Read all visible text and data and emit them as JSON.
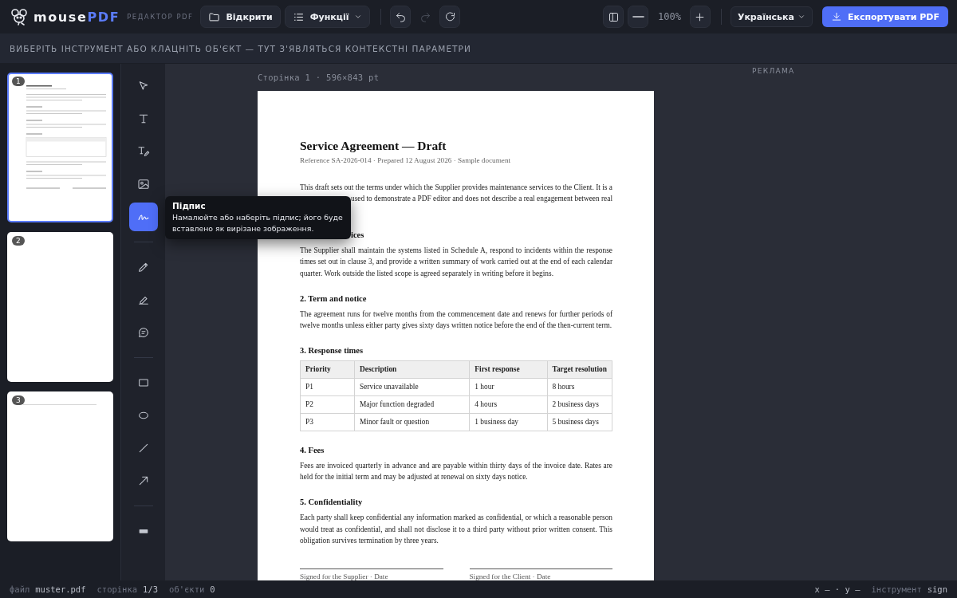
{
  "logo": {
    "name": "mouse",
    "accent": "PDF",
    "subtitle": "РЕДАКТОР PDF"
  },
  "toolbar": {
    "left": [
      {
        "kind": "open",
        "label": "Відкрити",
        "disabled": false
      },
      {
        "kind": "menu",
        "label": "Функції",
        "disabled": false
      },
      {
        "kind": "undo",
        "disabled": false
      },
      {
        "kind": "redo",
        "disabled": true
      },
      {
        "kind": "refresh",
        "disabled": false
      }
    ],
    "right": [
      {
        "kind": "panel",
        "disabled": false
      },
      {
        "kind": "zoom-out",
        "disabled": false
      },
      {
        "kind": "zoom-level",
        "label": "100%"
      },
      {
        "kind": "zoom-in",
        "disabled": false
      }
    ],
    "language": "Українська",
    "export": "Експортувати PDF"
  },
  "context_hint": "ВИБЕРІТЬ ІНСТРУМЕНТ АБО КЛАЦНІТЬ ОБ'ЄКТ — ТУТ З'ЯВЛЯТЬСЯ КОНТЕКСТНІ ПАРАМЕТРИ",
  "thumbnails": [
    {
      "number": "1",
      "selected": true,
      "kind": "document"
    },
    {
      "number": "2",
      "selected": false,
      "kind": "blank"
    },
    {
      "number": "3",
      "selected": false,
      "kind": "line"
    }
  ],
  "tools": [
    {
      "kind": "select",
      "selected": false
    },
    {
      "kind": "text",
      "selected": false
    },
    {
      "kind": "edit-text",
      "selected": false
    },
    {
      "kind": "image",
      "selected": false
    },
    {
      "kind": "signature",
      "selected": true
    },
    {
      "kind": "divider"
    },
    {
      "kind": "pencil",
      "selected": false
    },
    {
      "kind": "highlighter",
      "selected": false
    },
    {
      "kind": "comment",
      "selected": false
    },
    {
      "kind": "divider"
    },
    {
      "kind": "rectangle",
      "selected": false
    },
    {
      "kind": "ellipse",
      "selected": false
    },
    {
      "kind": "line",
      "selected": false
    },
    {
      "kind": "arrow",
      "selected": false
    },
    {
      "kind": "divider"
    },
    {
      "kind": "redact",
      "selected": false
    }
  ],
  "tooltip": {
    "title": "Підпис",
    "text": "Намалюйте або наберіть підпис; його буде вставлено як вирізане зображення."
  },
  "page_label": "Сторінка 1 · 596×843 pt",
  "ad_label": "РЕКЛАМА",
  "document": {
    "title": "Service Agreement — Draft",
    "reference": "Reference SA-2026-014 · Prepared 12 August 2026 · Sample document",
    "blocks": [
      {
        "kind": "line",
        "text": "This draft sets out the terms under which the Supplier provides maintenance services to the Client. It is a"
      },
      {
        "kind": "line-end",
        "text": "used to demonstrate a PDF editor and does not describe a real engagement between real"
      },
      {
        "kind": "heading-end",
        "text": "ices"
      },
      {
        "kind": "paragraph",
        "text": "The Supplier shall maintain the systems listed in Schedule A, respond to incidents within the response times set out in clause 3, and provide a written summary of work carried out at the end of each calendar quarter. Work outside the listed scope is agreed separately in writing before it begins."
      },
      {
        "kind": "heading",
        "text": "2. Term and notice"
      },
      {
        "kind": "paragraph",
        "text": "The agreement runs for twelve months from the commencement date and renews for further periods of twelve months unless either party gives sixty days written notice before the end of the then-current term."
      },
      {
        "kind": "heading",
        "text": "3. Response times"
      },
      {
        "kind": "table",
        "columns": [
          "Priority",
          "Description",
          "First response",
          "Target resolution"
        ],
        "rows": [
          [
            "P1",
            "Service unavailable",
            "1 hour",
            "8 hours"
          ],
          [
            "P2",
            "Major function degraded",
            "4 hours",
            "2 business days"
          ],
          [
            "P3",
            "Minor fault or question",
            "1 business day",
            "5 business days"
          ]
        ]
      },
      {
        "kind": "heading",
        "text": "4. Fees"
      },
      {
        "kind": "paragraph",
        "text": "Fees are invoiced quarterly in advance and are payable within thirty days of the invoice date. Rates are held for the initial term and may be adjusted at renewal on sixty days notice."
      },
      {
        "kind": "heading",
        "text": "5. Confidentiality"
      },
      {
        "kind": "paragraph",
        "text": "Each party shall keep confidential any information marked as confidential, or which a reasonable person would treat as confidential, and shall not disclose it to a third party without prior written consent. This obligation survives termination by three years."
      },
      {
        "kind": "signatures",
        "items": [
          "Signed for the Supplier · Date",
          "Signed for the Client · Date"
        ]
      }
    ]
  },
  "status_bar": {
    "left": [
      {
        "label": "файл",
        "value": "muster.pdf"
      },
      {
        "label": "сторінка",
        "value": "1/3"
      },
      {
        "label": "об'єкти",
        "value": "0"
      }
    ],
    "cursor": "x — · y —",
    "tool": {
      "label": "інструмент",
      "value": "sign"
    }
  }
}
